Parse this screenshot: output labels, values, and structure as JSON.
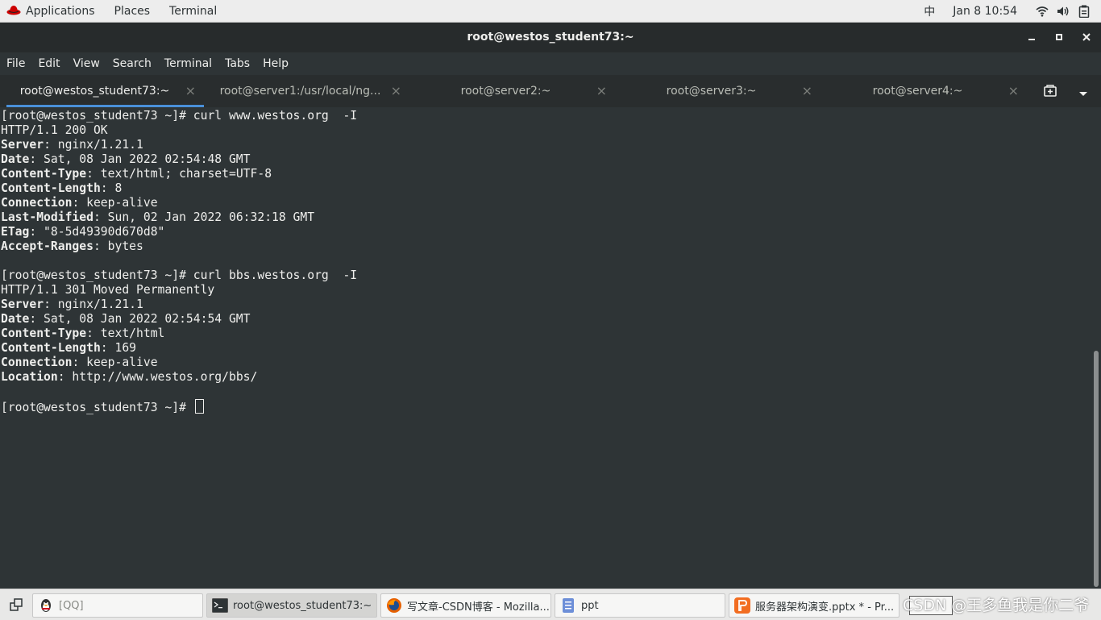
{
  "top_panel": {
    "applications": "Applications",
    "places": "Places",
    "terminal": "Terminal",
    "input_method": "中",
    "clock": "Jan 8  10:54"
  },
  "window": {
    "title": "root@westos_student73:~"
  },
  "menubar": [
    "File",
    "Edit",
    "View",
    "Search",
    "Terminal",
    "Tabs",
    "Help"
  ],
  "tabs": [
    {
      "label": "root@westos_student73:~",
      "active": true
    },
    {
      "label": "root@server1:/usr/local/ng...",
      "active": false
    },
    {
      "label": "root@server2:~",
      "active": false
    },
    {
      "label": "root@server3:~",
      "active": false
    },
    {
      "label": "root@server4:~",
      "active": false
    }
  ],
  "tab_close": "×",
  "terminal": {
    "prompt": "[root@westos_student73 ~]# ",
    "cmd1": "curl www.westos.org  -I",
    "resp1": {
      "status": "HTTP/1.1 200 OK",
      "headers": [
        {
          "k": "Server",
          "v": ": nginx/1.21.1"
        },
        {
          "k": "Date",
          "v": ": Sat, 08 Jan 2022 02:54:48 GMT"
        },
        {
          "k": "Content-Type",
          "v": ": text/html; charset=UTF-8"
        },
        {
          "k": "Content-Length",
          "v": ": 8"
        },
        {
          "k": "Connection",
          "v": ": keep-alive"
        },
        {
          "k": "Last-Modified",
          "v": ": Sun, 02 Jan 2022 06:32:18 GMT"
        },
        {
          "k": "ETag",
          "v": ": \"8-5d49390d670d8\""
        },
        {
          "k": "Accept-Ranges",
          "v": ": bytes"
        }
      ]
    },
    "cmd2": "curl bbs.westos.org  -I",
    "resp2": {
      "status": "HTTP/1.1 301 Moved Permanently",
      "headers": [
        {
          "k": "Server",
          "v": ": nginx/1.21.1"
        },
        {
          "k": "Date",
          "v": ": Sat, 08 Jan 2022 02:54:54 GMT"
        },
        {
          "k": "Content-Type",
          "v": ": text/html"
        },
        {
          "k": "Content-Length",
          "v": ": 169"
        },
        {
          "k": "Connection",
          "v": ": keep-alive"
        },
        {
          "k": "Location",
          "v": ": http://www.westos.org/bbs/"
        }
      ]
    }
  },
  "taskbar": {
    "qq": "[QQ]",
    "terminal": "root@westos_student73:~",
    "firefox": "写文章-CSDN博客 - Mozilla...",
    "ppt": "ppt",
    "pptx": "服务器架构演变.pptx * - Pr..."
  },
  "watermark": "CSDN @王多鱼我是你二爷",
  "colors": {
    "accent": "#4a90d9",
    "terminal_bg": "#2e3436",
    "terminal_fg": "#eeeeec"
  }
}
